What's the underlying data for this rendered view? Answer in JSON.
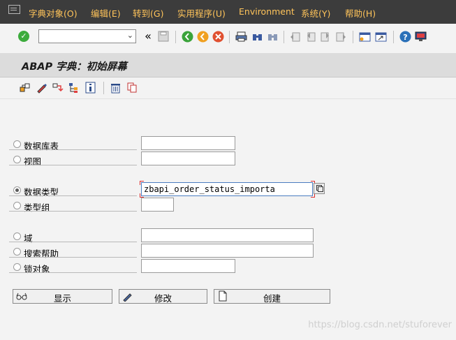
{
  "menubar": {
    "items": [
      "字典对象(O)",
      "编辑(E)",
      "转到(G)",
      "实用程序(U)",
      "Environment",
      "系统(Y)",
      "帮助(H)"
    ]
  },
  "toolbar": {
    "command_value": "",
    "back_glyph": "«"
  },
  "title": "ABAP 字典：初始屏幕",
  "options": [
    {
      "label": "数据库表",
      "value": "",
      "selected": false
    },
    {
      "label": "视图",
      "value": "",
      "selected": false
    },
    {
      "label": "数据类型",
      "value": "zbapi_order_status_importa",
      "selected": true
    },
    {
      "label": "类型组",
      "value": "",
      "selected": false
    },
    {
      "label": "域",
      "value": "",
      "selected": false
    },
    {
      "label": "搜索帮助",
      "value": "",
      "selected": false
    },
    {
      "label": "锁对象",
      "value": "",
      "selected": false
    }
  ],
  "buttons": {
    "display": "显示",
    "change": "修改",
    "create": "创建"
  },
  "watermark": "https://blog.csdn.net/stuforever",
  "colors": {
    "menubar_bg": "#3c3c3c",
    "menu_text": "#ffc45a",
    "title_bg": "#dcdcdc",
    "active_border": "#4a7cc0",
    "required_marker": "#e03030"
  },
  "icons": {
    "ok": "check-icon",
    "save": "save-icon",
    "back": "back-icon",
    "exit": "exit-icon",
    "cancel": "cancel-icon",
    "print": "print-icon",
    "find": "find-icon",
    "find_next": "find-next-icon",
    "first_page": "first-page-icon",
    "prev_page": "prev-page-icon",
    "next_page": "next-page-icon",
    "last_page": "last-page-icon",
    "new_session": "new-session-icon",
    "shortcut": "shortcut-icon",
    "help": "help-icon",
    "layout": "customize-layout-icon"
  }
}
